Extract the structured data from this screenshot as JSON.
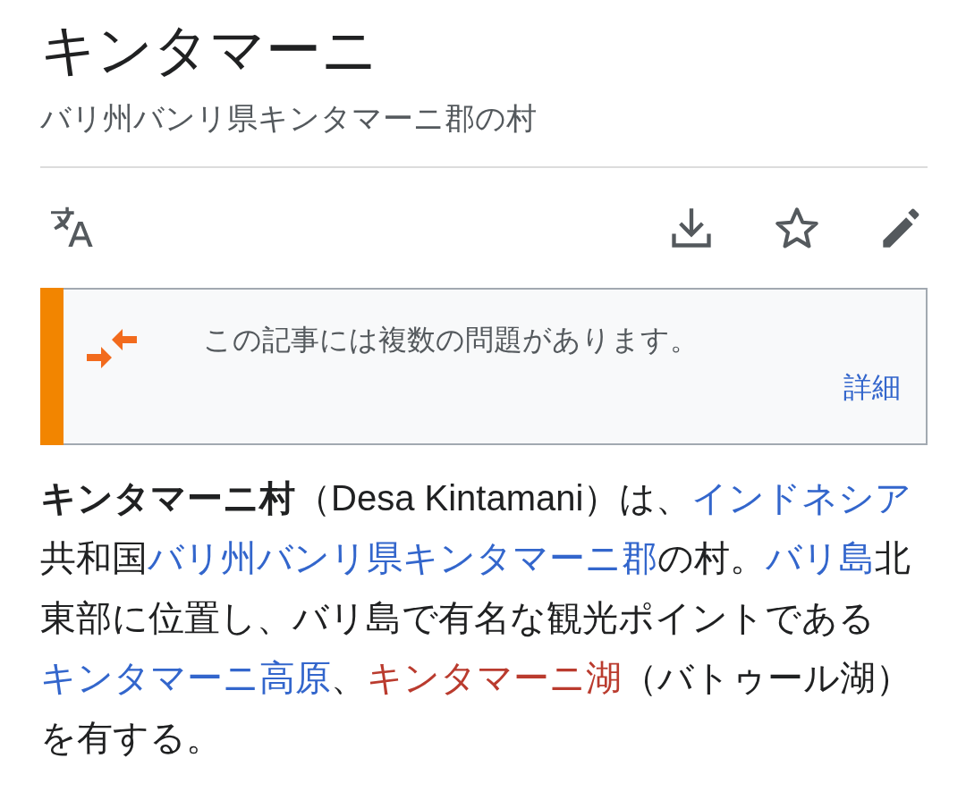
{
  "page": {
    "title": "キンタマーニ",
    "description": "バリ州バンリ県キンタマーニ郡の村"
  },
  "actions": [
    {
      "kind": "language"
    },
    {
      "kind": "download"
    },
    {
      "kind": "star"
    },
    {
      "kind": "edit"
    }
  ],
  "notice": {
    "text": "この記事には複数の問題があります。",
    "link": "詳細"
  },
  "paragraph": [
    {
      "kind": "bold",
      "text": "キンタマーニ村"
    },
    {
      "kind": "text",
      "text": "（Desa Kintamani）は、"
    },
    {
      "kind": "link",
      "text": "インドネシア"
    },
    {
      "kind": "text",
      "text": "共和国"
    },
    {
      "kind": "link",
      "text": "バリ州バンリ県キンタマーニ郡"
    },
    {
      "kind": "text",
      "text": "の村。"
    },
    {
      "kind": "link",
      "text": "バリ島"
    },
    {
      "kind": "text",
      "text": "北東部に位置し、バリ島で有名な観光ポイントである"
    },
    {
      "kind": "link",
      "text": "キンタマーニ高原"
    },
    {
      "kind": "text",
      "text": "、"
    },
    {
      "kind": "redlink",
      "text": "キンタマーニ湖"
    },
    {
      "kind": "text",
      "text": "（バトゥール湖）を有する。"
    }
  ]
}
